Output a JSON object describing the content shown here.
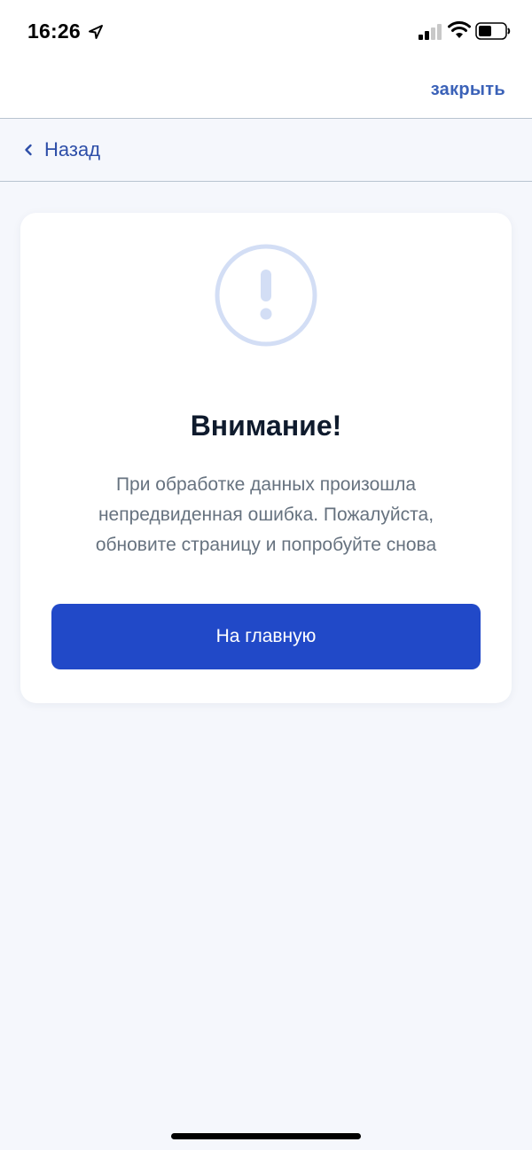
{
  "status_bar": {
    "time": "16:26",
    "icons": [
      "location-arrow-icon",
      "cellular-signal-icon",
      "wifi-icon",
      "battery-icon"
    ]
  },
  "top_bar": {
    "close_label": "закрыть"
  },
  "nav": {
    "back_label": "Назад",
    "back_icon": "chevron-left-icon"
  },
  "card": {
    "icon": "exclamation-circle-icon",
    "title": "Внимание!",
    "message": "При обработке данных произошла непредвиденная ошибка. Пожалуйста, обновите страницу и попробуйте снова",
    "button_label": "На главную"
  },
  "colors": {
    "accent": "#2149c8",
    "link": "#3b62b8",
    "icon_ring": "#d3def5",
    "page_background": "#f5f7fc"
  }
}
